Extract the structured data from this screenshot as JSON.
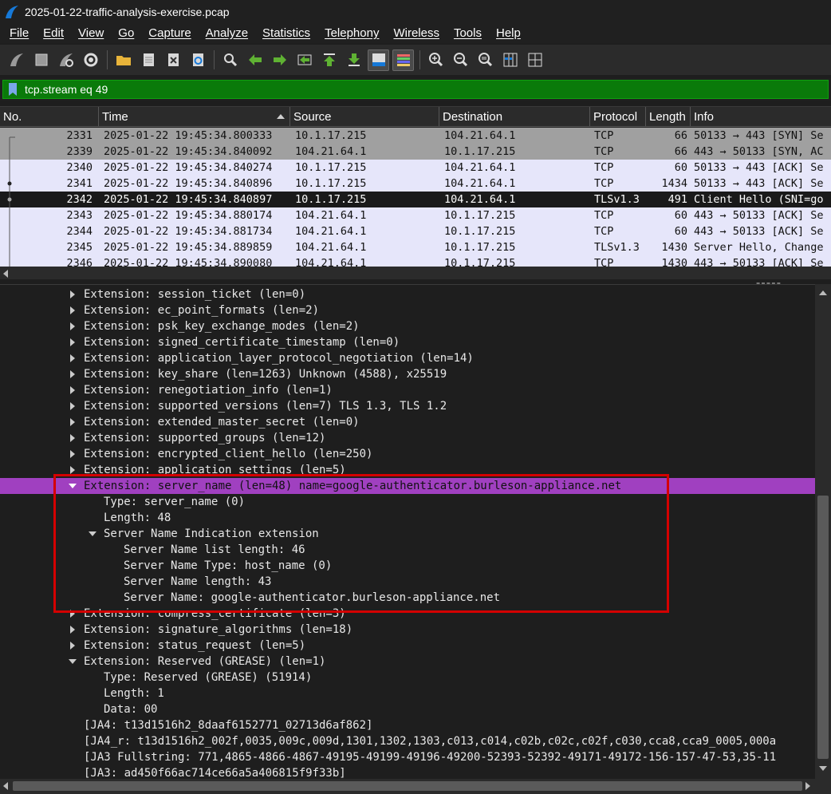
{
  "window": {
    "title": "2025-01-22-traffic-analysis-exercise.pcap"
  },
  "menu": [
    "File",
    "Edit",
    "View",
    "Go",
    "Capture",
    "Analyze",
    "Statistics",
    "Telephony",
    "Wireless",
    "Tools",
    "Help"
  ],
  "toolbar": {
    "icons": [
      "shark-fin-start-icon",
      "stop-icon",
      "restart-capture-icon",
      "capture-options-icon",
      "open-folder-icon",
      "save-file-icon",
      "close-file-icon",
      "reload-icon",
      "find-packet-icon",
      "go-back-icon",
      "go-forward-icon",
      "go-to-packet-icon",
      "go-first-icon",
      "go-last-icon",
      "autoscroll-icon",
      "colorize-icon",
      "zoom-in-icon",
      "zoom-out-icon",
      "zoom-normal-icon",
      "resize-columns-icon",
      "layout-icon"
    ]
  },
  "filter": {
    "text": "tcp.stream eq 49"
  },
  "packet_list": {
    "columns": [
      "No.",
      "Time",
      "Source",
      "Destination",
      "Protocol",
      "Length",
      "Info"
    ],
    "rows": [
      {
        "no": "2331",
        "time": "2025-01-22 19:45:34.800333",
        "src": "10.1.17.215",
        "dst": "104.21.64.1",
        "proto": "TCP",
        "len": "66",
        "info": "50133 → 443 [SYN] Se",
        "style": "gray"
      },
      {
        "no": "2339",
        "time": "2025-01-22 19:45:34.840092",
        "src": "104.21.64.1",
        "dst": "10.1.17.215",
        "proto": "TCP",
        "len": "66",
        "info": "443 → 50133 [SYN, AC",
        "style": "gray"
      },
      {
        "no": "2340",
        "time": "2025-01-22 19:45:34.840274",
        "src": "10.1.17.215",
        "dst": "104.21.64.1",
        "proto": "TCP",
        "len": "60",
        "info": "50133 → 443 [ACK] Se",
        "style": "lav"
      },
      {
        "no": "2341",
        "time": "2025-01-22 19:45:34.840896",
        "src": "10.1.17.215",
        "dst": "104.21.64.1",
        "proto": "TCP",
        "len": "1434",
        "info": "50133 → 443 [ACK] Se",
        "style": "lav"
      },
      {
        "no": "2342",
        "time": "2025-01-22 19:45:34.840897",
        "src": "10.1.17.215",
        "dst": "104.21.64.1",
        "proto": "TLSv1.3",
        "len": "491",
        "info": "Client Hello (SNI=go",
        "style": "sel"
      },
      {
        "no": "2343",
        "time": "2025-01-22 19:45:34.880174",
        "src": "104.21.64.1",
        "dst": "10.1.17.215",
        "proto": "TCP",
        "len": "60",
        "info": "443 → 50133 [ACK] Se",
        "style": "lav"
      },
      {
        "no": "2344",
        "time": "2025-01-22 19:45:34.881734",
        "src": "104.21.64.1",
        "dst": "10.1.17.215",
        "proto": "TCP",
        "len": "60",
        "info": "443 → 50133 [ACK] Se",
        "style": "lav"
      },
      {
        "no": "2345",
        "time": "2025-01-22 19:45:34.889859",
        "src": "104.21.64.1",
        "dst": "10.1.17.215",
        "proto": "TLSv1.3",
        "len": "1430",
        "info": "Server Hello, Change",
        "style": "lav"
      },
      {
        "no": "2346",
        "time": "2025-01-22 19:45:34.890080",
        "src": "104.21.64.1",
        "dst": "10.1.17.215",
        "proto": "TCP",
        "len": "1430",
        "info": "443 → 50133 [ACK] Se",
        "style": "lav"
      }
    ]
  },
  "details": [
    {
      "indent": 0,
      "expander": "right",
      "text": "Extension: session_ticket (len=0)"
    },
    {
      "indent": 0,
      "expander": "right",
      "text": "Extension: ec_point_formats (len=2)"
    },
    {
      "indent": 0,
      "expander": "right",
      "text": "Extension: psk_key_exchange_modes (len=2)"
    },
    {
      "indent": 0,
      "expander": "right",
      "text": "Extension: signed_certificate_timestamp (len=0)"
    },
    {
      "indent": 0,
      "expander": "right",
      "text": "Extension: application_layer_protocol_negotiation (len=14)"
    },
    {
      "indent": 0,
      "expander": "right",
      "text": "Extension: key_share (len=1263) Unknown (4588), x25519"
    },
    {
      "indent": 0,
      "expander": "right",
      "text": "Extension: renegotiation_info (len=1)"
    },
    {
      "indent": 0,
      "expander": "right",
      "text": "Extension: supported_versions (len=7) TLS 1.3, TLS 1.2"
    },
    {
      "indent": 0,
      "expander": "right",
      "text": "Extension: extended_master_secret (len=0)"
    },
    {
      "indent": 0,
      "expander": "right",
      "text": "Extension: supported_groups (len=12)"
    },
    {
      "indent": 0,
      "expander": "right",
      "text": "Extension: encrypted_client_hello (len=250)"
    },
    {
      "indent": 0,
      "expander": "right",
      "text": "Extension: application_settings (len=5)"
    },
    {
      "indent": 0,
      "expander": "down",
      "text": "Extension: server_name (len=48) name=google-authenticator.burleson-appliance.net",
      "highlight": true
    },
    {
      "indent": 1,
      "expander": "",
      "text": "Type: server_name (0)"
    },
    {
      "indent": 1,
      "expander": "",
      "text": "Length: 48"
    },
    {
      "indent": 1,
      "expander": "down",
      "text": "Server Name Indication extension"
    },
    {
      "indent": 2,
      "expander": "",
      "text": "Server Name list length: 46"
    },
    {
      "indent": 2,
      "expander": "",
      "text": "Server Name Type: host_name (0)"
    },
    {
      "indent": 2,
      "expander": "",
      "text": "Server Name length: 43"
    },
    {
      "indent": 2,
      "expander": "",
      "text": "Server Name: google-authenticator.burleson-appliance.net"
    },
    {
      "indent": 0,
      "expander": "right",
      "text": "Extension: compress_certificate (len=3)"
    },
    {
      "indent": 0,
      "expander": "right",
      "text": "Extension: signature_algorithms (len=18)"
    },
    {
      "indent": 0,
      "expander": "right",
      "text": "Extension: status_request (len=5)"
    },
    {
      "indent": 0,
      "expander": "down",
      "text": "Extension: Reserved (GREASE) (len=1)"
    },
    {
      "indent": 1,
      "expander": "",
      "text": "Type: Reserved (GREASE) (51914)"
    },
    {
      "indent": 1,
      "expander": "",
      "text": "Length: 1"
    },
    {
      "indent": 1,
      "expander": "",
      "text": "Data: 00"
    },
    {
      "indent": 0,
      "expander": "none",
      "text": "[JA4: t13d1516h2_8daaf6152771_02713d6af862]"
    },
    {
      "indent": 0,
      "expander": "none",
      "text": "[JA4_r: t13d1516h2_002f,0035,009c,009d,1301,1302,1303,c013,c014,c02b,c02c,c02f,c030,cca8,cca9_0005,000a"
    },
    {
      "indent": 0,
      "expander": "none",
      "text": "[JA3 Fullstring: 771,4865-4866-4867-49195-49199-49196-49200-52393-52392-49171-49172-156-157-47-53,35-11"
    },
    {
      "indent": 0,
      "expander": "none",
      "text": "[JA3: ad450f66ac714ce66a5a406815f9f33b]"
    }
  ],
  "colors": {
    "filter_bg": "#0a7a0a",
    "highlight_row": "#a040c0",
    "annotation_box": "#d40000"
  }
}
